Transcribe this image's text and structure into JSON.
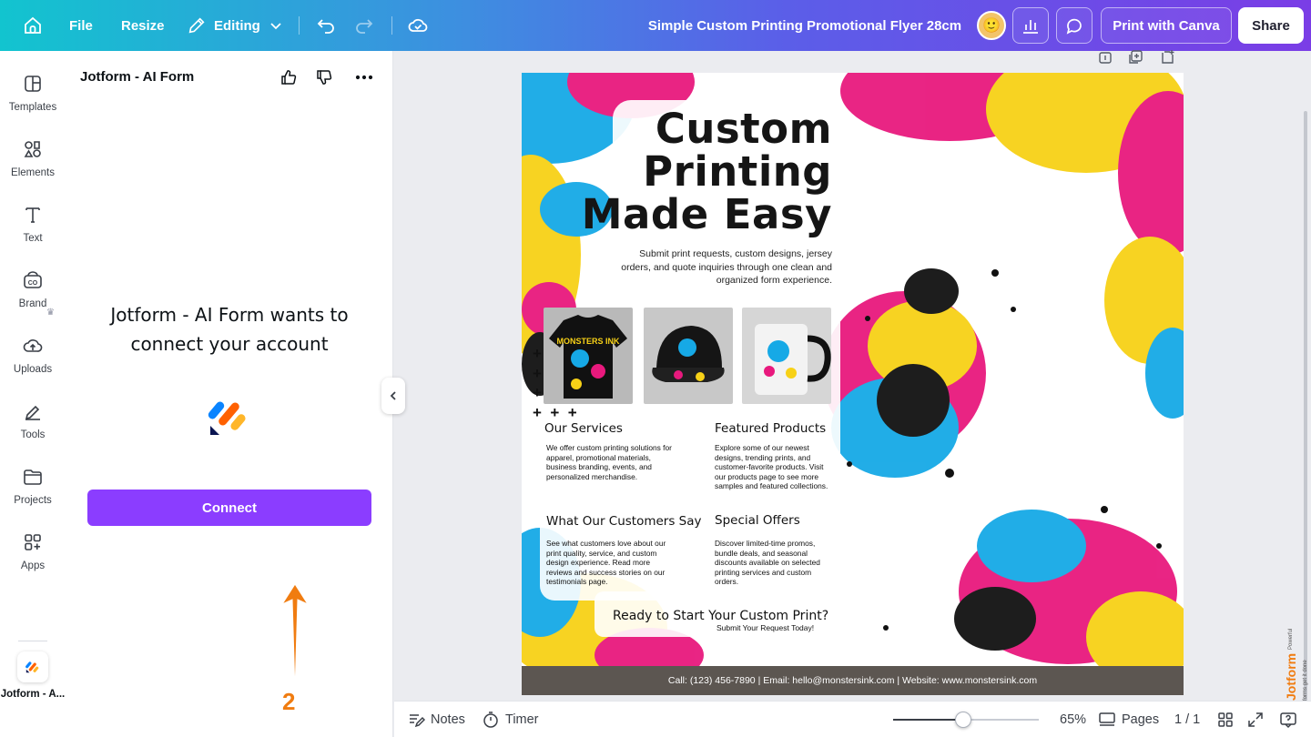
{
  "topbar": {
    "menu": [
      "File",
      "Resize",
      "Editing"
    ],
    "doc_title": "Simple Custom Printing Promotional Flyer 28cm",
    "print_button": "Print with Canva",
    "share_button": "Share",
    "icons": [
      "home-icon",
      "pencil-icon",
      "chevron-down-icon",
      "undo-icon",
      "redo-icon",
      "cloud-check-icon",
      "avatar",
      "analytics-icon",
      "comment-icon"
    ]
  },
  "rail": {
    "items": [
      {
        "label": "Templates",
        "icon": "templates-icon"
      },
      {
        "label": "Elements",
        "icon": "elements-icon"
      },
      {
        "label": "Text",
        "icon": "text-icon"
      },
      {
        "label": "Brand",
        "icon": "brand-icon"
      },
      {
        "label": "Uploads",
        "icon": "uploads-icon"
      },
      {
        "label": "Tools",
        "icon": "tools-icon"
      },
      {
        "label": "Projects",
        "icon": "projects-icon"
      },
      {
        "label": "Apps",
        "icon": "apps-icon"
      }
    ],
    "active_app": "Jotform - A..."
  },
  "panel": {
    "title": "Jotform - AI Form",
    "heading_line1": "Jotform - AI Form wants to",
    "heading_line2": "connect your account",
    "connect_button": "Connect",
    "annotation_number": "2"
  },
  "flyer": {
    "title_line1": "Custom",
    "title_line2": "Printing",
    "title_line3": "Made Easy",
    "subtitle_line1": "Submit print requests, custom designs, jersey",
    "subtitle_line2": "orders, and quote inquiries through one clean and",
    "subtitle_line3": "organized form experience.",
    "products": [
      "jersey",
      "cap",
      "mug"
    ],
    "product_brand": "MONSTERS INK",
    "sections": {
      "services_title": "Our Services",
      "services_text": "We offer custom printing solutions for apparel, promotional materials, business branding, events, and personalized merchandise.",
      "featured_title": "Featured Products",
      "featured_text": "Explore some of our newest designs, trending prints, and customer-favorite products. Visit our products page to see more samples and featured collections.",
      "customers_title": "What Our Customers Say",
      "customers_text": "See what customers love about our print quality, service, and custom design experience. Read more reviews and success stories on our testimonials page.",
      "offers_title": "Special Offers",
      "offers_text": "Discover limited-time promos, bundle deals, and seasonal discounts available on selected printing services and custom orders."
    },
    "cta_title": "Ready to Start Your Custom Print?",
    "cta_sub": "Submit Your Request Today!",
    "footer": "Call: (123) 456-7890 | Email: hello@monstersink.com | Website: www.monstersink.com"
  },
  "bottombar": {
    "notes": "Notes",
    "timer": "Timer",
    "zoom": "65%",
    "zoom_level": 0.48,
    "pages": "Pages",
    "page_count": "1 / 1"
  },
  "watermark": {
    "brand": "Jotform",
    "tagline": "Powerful forms get it done"
  },
  "colors": {
    "accent": "#8b3dff",
    "cyan": "#16a9e6",
    "magenta": "#e8197d",
    "yellow": "#f7d117",
    "footer": "#5c5651",
    "annotation": "#f07c10"
  }
}
